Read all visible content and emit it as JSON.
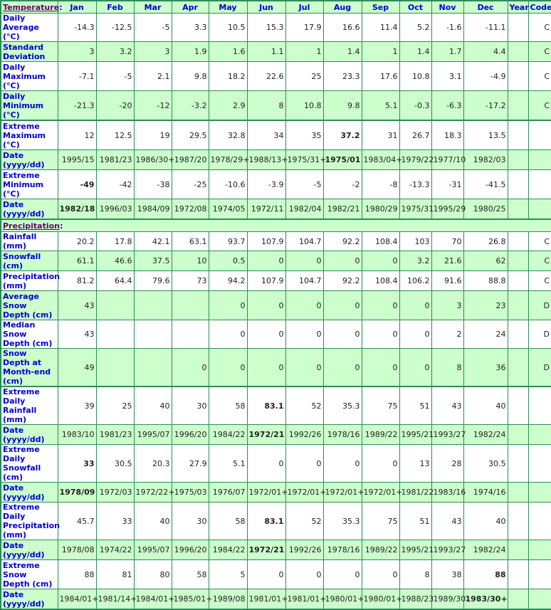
{
  "columns": [
    "Jan",
    "Feb",
    "Mar",
    "Apr",
    "May",
    "Jun",
    "Jul",
    "Aug",
    "Sep",
    "Oct",
    "Nov",
    "Dec",
    "Year",
    "Code"
  ],
  "sections": {
    "temperature": {
      "label": "Temperature",
      "colon": ":"
    },
    "precipitation": {
      "label": "Precipitation",
      "colon": ":"
    }
  },
  "temperature_rows": [
    {
      "label": "Daily Average (°C)",
      "values": [
        "-14.3",
        "-12.5",
        "-5",
        "3.3",
        "10.5",
        "15.3",
        "17.9",
        "16.6",
        "11.4",
        "5.2",
        "-1.6",
        "-11.1",
        "",
        "C"
      ],
      "bold": []
    },
    {
      "label": "Standard Deviation",
      "values": [
        "3",
        "3.2",
        "3",
        "1.9",
        "1.6",
        "1.1",
        "1",
        "1.4",
        "1",
        "1.4",
        "1.7",
        "4.4",
        "",
        "C"
      ],
      "bold": []
    },
    {
      "label": "Daily Maximum (°C)",
      "values": [
        "-7.1",
        "-5",
        "2.1",
        "9.8",
        "18.2",
        "22.6",
        "25",
        "23.3",
        "17.6",
        "10.8",
        "3.1",
        "-4.9",
        "",
        "C"
      ],
      "bold": []
    },
    {
      "label": "Daily Minimum (°C)",
      "values": [
        "-21.3",
        "-20",
        "-12",
        "-3.2",
        "2.9",
        "8",
        "10.8",
        "9.8",
        "5.1",
        "-0.3",
        "-6.3",
        "-17.2",
        "",
        "C"
      ],
      "bold": []
    },
    {
      "label": "Extreme Maximum (°C)",
      "values": [
        "12",
        "12.5",
        "19",
        "29.5",
        "32.8",
        "34",
        "35",
        "37.2",
        "31",
        "26.7",
        "18.3",
        "13.5",
        "",
        ""
      ],
      "bold": [
        7
      ]
    },
    {
      "label": "Date (yyyy/dd)",
      "values": [
        "1995/15",
        "1981/23",
        "1986/30+",
        "1987/20",
        "1978/29+",
        "1988/13+",
        "1975/31+",
        "1975/01",
        "1983/04+",
        "1979/22",
        "1977/10",
        "1982/03",
        "",
        ""
      ],
      "bold": [
        7
      ]
    },
    {
      "label": "Extreme Minimum (°C)",
      "values": [
        "-49",
        "-42",
        "-38",
        "-25",
        "-10.6",
        "-3.9",
        "-5",
        "-2",
        "-8",
        "-13.3",
        "-31",
        "-41.5",
        "",
        ""
      ],
      "bold": [
        0
      ]
    },
    {
      "label": "Date (yyyy/dd)",
      "values": [
        "1982/18",
        "1996/03",
        "1984/09",
        "1972/08",
        "1974/05",
        "1972/11",
        "1982/04",
        "1982/21",
        "1980/29",
        "1975/31",
        "1995/29",
        "1980/25",
        "",
        ""
      ],
      "bold": [
        0
      ]
    }
  ],
  "precipitation_rows": [
    {
      "label": "Rainfall (mm)",
      "values": [
        "20.2",
        "17.8",
        "42.1",
        "63.1",
        "93.7",
        "107.9",
        "104.7",
        "92.2",
        "108.4",
        "103",
        "70",
        "26.8",
        "",
        "C"
      ],
      "bold": []
    },
    {
      "label": "Snowfall (cm)",
      "values": [
        "61.1",
        "46.6",
        "37.5",
        "10",
        "0.5",
        "0",
        "0",
        "0",
        "0",
        "3.2",
        "21.6",
        "62",
        "",
        "C"
      ],
      "bold": []
    },
    {
      "label": "Precipitation (mm)",
      "values": [
        "81.2",
        "64.4",
        "79.6",
        "73",
        "94.2",
        "107.9",
        "104.7",
        "92.2",
        "108.4",
        "106.2",
        "91.6",
        "88.8",
        "",
        "C"
      ],
      "bold": []
    },
    {
      "label": "Average Snow Depth (cm)",
      "values": [
        "43",
        "",
        "",
        "",
        "0",
        "0",
        "0",
        "0",
        "0",
        "0",
        "3",
        "23",
        "",
        "D"
      ],
      "bold": []
    },
    {
      "label": "Median Snow Depth (cm)",
      "values": [
        "43",
        "",
        "",
        "",
        "0",
        "0",
        "0",
        "0",
        "0",
        "0",
        "2",
        "24",
        "",
        "D"
      ],
      "bold": []
    },
    {
      "label": "Snow Depth at Month-end (cm)",
      "values": [
        "49",
        "",
        "",
        "0",
        "0",
        "0",
        "0",
        "0",
        "0",
        "0",
        "8",
        "36",
        "",
        "D"
      ],
      "bold": []
    },
    {
      "label": "Extreme Daily Rainfall (mm)",
      "values": [
        "39",
        "25",
        "40",
        "30",
        "58",
        "83.1",
        "52",
        "35.3",
        "75",
        "51",
        "43",
        "40",
        "",
        ""
      ],
      "bold": [
        5
      ]
    },
    {
      "label": "Date (yyyy/dd)",
      "values": [
        "1983/10",
        "1981/23",
        "1995/07",
        "1996/20",
        "1984/22",
        "1972/21",
        "1992/26",
        "1978/16",
        "1989/22",
        "1995/21",
        "1993/27",
        "1982/24",
        "",
        ""
      ],
      "bold": [
        5
      ]
    },
    {
      "label": "Extreme Daily Snowfall (cm)",
      "values": [
        "33",
        "30.5",
        "20.3",
        "27.9",
        "5.1",
        "0",
        "0",
        "0",
        "0",
        "13",
        "28",
        "30.5",
        "",
        ""
      ],
      "bold": [
        0
      ]
    },
    {
      "label": "Date (yyyy/dd)",
      "values": [
        "1978/09",
        "1972/03",
        "1972/22+",
        "1975/03",
        "1976/07",
        "1972/01+",
        "1972/01+",
        "1972/01+",
        "1972/01+",
        "1981/22",
        "1983/16",
        "1974/16",
        "",
        ""
      ],
      "bold": [
        0
      ]
    },
    {
      "label": "Extreme Daily Precipitation (mm)",
      "values": [
        "45.7",
        "33",
        "40",
        "30",
        "58",
        "83.1",
        "52",
        "35.3",
        "75",
        "51",
        "43",
        "40",
        "",
        ""
      ],
      "bold": [
        5
      ]
    },
    {
      "label": "Date (yyyy/dd)",
      "values": [
        "1978/08",
        "1974/22",
        "1995/07",
        "1996/20",
        "1984/22",
        "1972/21",
        "1992/26",
        "1978/16",
        "1989/22",
        "1995/21",
        "1993/27",
        "1982/24",
        "",
        ""
      ],
      "bold": [
        5
      ]
    },
    {
      "label": "Extreme Snow Depth (cm)",
      "values": [
        "88",
        "81",
        "80",
        "58",
        "5",
        "0",
        "0",
        "0",
        "0",
        "8",
        "38",
        "88",
        "",
        ""
      ],
      "bold": [
        11
      ]
    },
    {
      "label": "Date (yyyy/dd)",
      "values": [
        "1984/01+",
        "1981/14+",
        "1984/01+",
        "1985/01+",
        "1989/08",
        "1981/01+",
        "1981/01+",
        "1980/01+",
        "1980/01+",
        "1988/23",
        "1989/30",
        "1983/30+",
        "",
        ""
      ],
      "bold": [
        11
      ]
    }
  ],
  "colors": {
    "header_bg": "#ccffcc",
    "label_blue": "#0000cc",
    "section_purple": "#660066",
    "border_green": "#2e8b57"
  }
}
